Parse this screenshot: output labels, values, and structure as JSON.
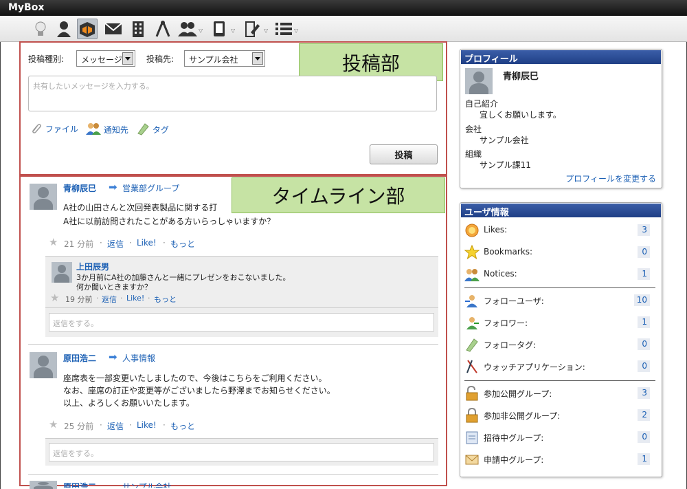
{
  "app": {
    "title": "MyBox"
  },
  "toolbar": {
    "icons": [
      "lightbulb-icon",
      "user-icon",
      "box-icon",
      "mail-icon",
      "building-icon",
      "compass-icon",
      "group-icon",
      "tablet-icon",
      "edit-icon",
      "list-icon"
    ]
  },
  "post": {
    "type_label": "投稿種別:",
    "type_value": "メッセージ",
    "dest_label": "投稿先:",
    "dest_value": "サンプル会社",
    "placeholder": "共有したいメッセージを入力する。",
    "file_label": "ファイル",
    "notify_label": "通知先",
    "tag_label": "タグ",
    "submit_label": "投稿",
    "section_label": "投稿部"
  },
  "timeline": {
    "section_label": "タイムライン部",
    "reply_placeholder": "返信をする。",
    "posts": [
      {
        "author": "青柳辰巳",
        "target": "営業部グループ",
        "lines": [
          "A社の山田さんと次回発表製品に関する打",
          "A社に以前訪問されたことがある方いらっしゃいますか？"
        ],
        "time": "21 分前",
        "reply": "返信",
        "like": "Like!",
        "more": "もっと",
        "comment": {
          "author": "上田辰男",
          "lines": [
            "3か月前にA社の加藤さんと一緒にプレゼンをおこないました。",
            "何か聞いときますか？"
          ],
          "time": "19 分前",
          "reply": "返信",
          "like": "Like!",
          "more": "もっと"
        }
      },
      {
        "author": "原田浩二",
        "target": "人事情報",
        "lines": [
          "座席表を一部変更いたしましたので、今後はこちらをご利用ください。",
          "なお、座席の訂正や変更等がございましたら野澤までお知らせください。",
          "以上、よろしくお願いいたします。"
        ],
        "time": "25 分前",
        "reply": "返信",
        "like": "Like!",
        "more": "もっと"
      }
    ],
    "partial_author": "原田浩二",
    "partial_target": "サンプル会社"
  },
  "profile": {
    "heading": "プロフィール",
    "name": "青柳辰巳",
    "intro_label": "自己紹介",
    "intro_value": "宜しくお願いします。",
    "company_label": "会社",
    "company_value": "サンプル会社",
    "org_label": "組織",
    "org_value": "サンプル課11",
    "edit_link": "プロフィールを変更する"
  },
  "user_info": {
    "heading": "ユーザ情報",
    "group1": [
      {
        "icon": "likes-icon",
        "label": "Likes:",
        "count": "3"
      },
      {
        "icon": "bookmark-star-icon",
        "label": "Bookmarks:",
        "count": "0"
      },
      {
        "icon": "notices-icon",
        "label": "Notices:",
        "count": "1"
      }
    ],
    "group2": [
      {
        "icon": "follow-user-icon",
        "label": "フォローユーザ:",
        "count": "10"
      },
      {
        "icon": "follower-icon",
        "label": "フォロワー:",
        "count": "1"
      },
      {
        "icon": "follow-tag-icon",
        "label": "フォロータグ:",
        "count": "0"
      },
      {
        "icon": "watch-app-icon",
        "label": "ウォッチアプリケーション:",
        "count": "0"
      }
    ],
    "group3": [
      {
        "icon": "public-group-icon",
        "label": "参加公開グループ:",
        "count": "3"
      },
      {
        "icon": "private-group-icon",
        "label": "参加非公開グループ:",
        "count": "2"
      },
      {
        "icon": "invite-group-icon",
        "label": "招待中グループ:",
        "count": "0"
      },
      {
        "icon": "apply-group-icon",
        "label": "申請中グループ:",
        "count": "1"
      }
    ]
  }
}
